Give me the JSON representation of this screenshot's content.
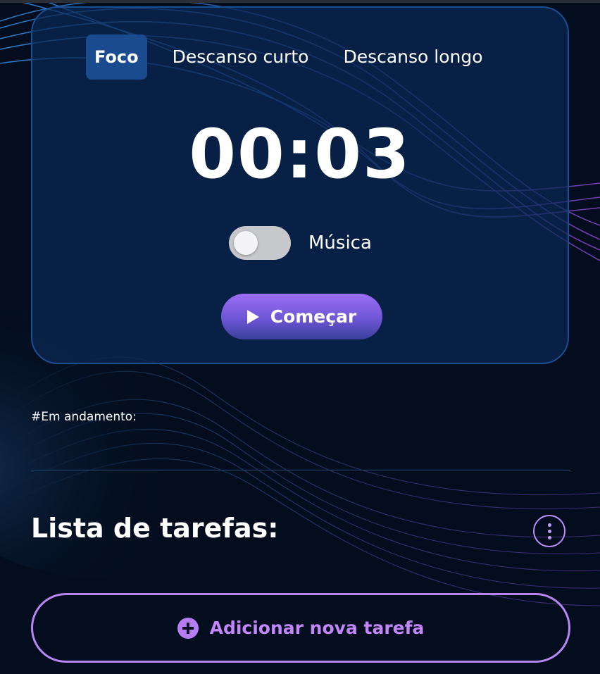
{
  "timer_card": {
    "tabs": [
      {
        "label": "Foco",
        "active": true
      },
      {
        "label": "Descanso curto",
        "active": false
      },
      {
        "label": "Descanso longo",
        "active": false
      }
    ],
    "time": "00:03",
    "music": {
      "label": "Música",
      "enabled": false
    },
    "start_button": {
      "label": "Começar",
      "icon": "play-icon"
    }
  },
  "in_progress_label": "#Em andamento:",
  "tasks": {
    "title": "Lista de tarefas:",
    "menu_icon": "vertical-dots-icon",
    "add_button": {
      "label": "Adicionar nova tarefa",
      "icon": "plus-circle-icon"
    }
  },
  "colors": {
    "background": "#030d1d",
    "card": "#0b2854",
    "card_border": "#1b4f93",
    "active_tab": "#1a4b8e",
    "accent_purple": "#b886f4",
    "start_gradient_top": "#9b6ef3",
    "start_gradient_bottom": "#3a3f9b"
  }
}
